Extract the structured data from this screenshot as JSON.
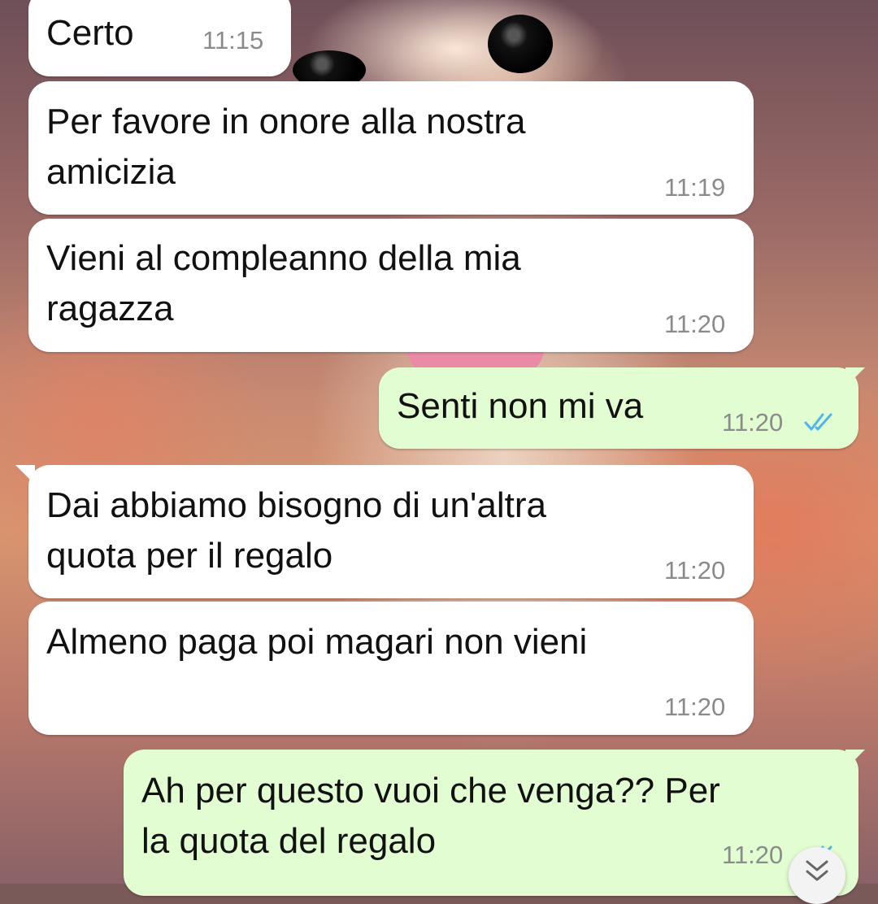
{
  "conversation": {
    "messages": [
      {
        "direction": "incoming",
        "text": "Certo",
        "time": "11:15"
      },
      {
        "direction": "incoming",
        "text": "Per favore in onore alla nostra\namicizia",
        "time": "11:19"
      },
      {
        "direction": "incoming",
        "text": "Vieni al compleanno della mia\nragazza",
        "time": "11:20"
      },
      {
        "direction": "outgoing",
        "text": "Senti non mi va",
        "time": "11:20",
        "status": "read"
      },
      {
        "direction": "incoming",
        "text": "Dai abbiamo bisogno di un'altra\nquota per il regalo",
        "time": "11:20"
      },
      {
        "direction": "incoming",
        "text": "Almeno paga poi magari non vieni",
        "time": "11:20"
      },
      {
        "direction": "outgoing",
        "text": "Ah per questo vuoi che venga?? Per\nla quota del regalo",
        "time": "11:20",
        "status": "read"
      }
    ]
  },
  "colors": {
    "incoming_bubble": "#ffffff",
    "outgoing_bubble": "#e2fdd1",
    "timestamp": "#8b8b8b",
    "read_ticks": "#4fb6ec"
  },
  "icons": {
    "read_receipt": "double-check-icon",
    "scroll_down": "double-chevron-down-icon"
  }
}
